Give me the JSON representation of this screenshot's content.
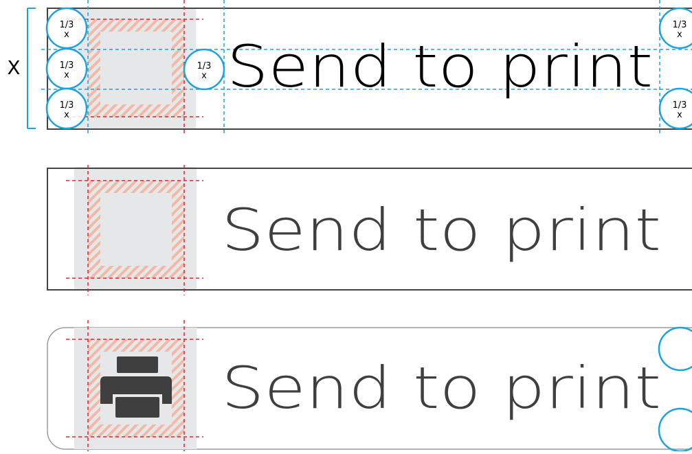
{
  "colors": {
    "guide_blue": "#1ea2dc",
    "guide_red": "#e8202a",
    "hatch": "#f2b9a7",
    "icon_bg": "#e6e7e8",
    "frame": "#444444",
    "text_dark": "#000000",
    "text_gray": "#3f3f3f",
    "frame_light": "#9a9a9a"
  },
  "dimension": {
    "label": "X"
  },
  "annotations": {
    "one_third_num": "1/3",
    "one_third_den": "x"
  },
  "buttons": [
    {
      "label": "Send to print",
      "icon": "placeholder-square-icon"
    },
    {
      "label": "Send to print",
      "icon": "placeholder-square-icon"
    },
    {
      "label": "Send to print",
      "icon": "printer-icon"
    }
  ]
}
